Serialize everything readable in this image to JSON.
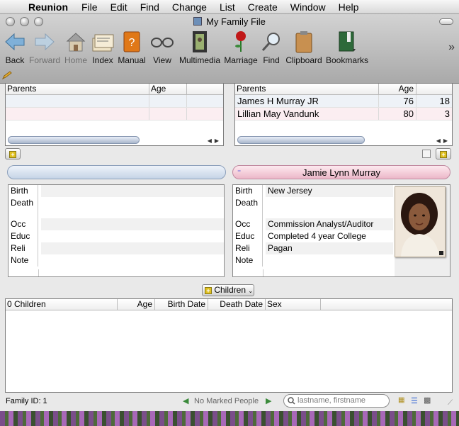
{
  "menubar": {
    "app_name": "Reunion",
    "items": [
      "File",
      "Edit",
      "Find",
      "Change",
      "List",
      "Create",
      "Window",
      "Help"
    ]
  },
  "window": {
    "title": "My Family File"
  },
  "toolbar": {
    "items": [
      {
        "label": "Back",
        "icon": "back-arrow-icon"
      },
      {
        "label": "Forward",
        "icon": "forward-arrow-icon",
        "disabled": true
      },
      {
        "label": "Home",
        "icon": "home-icon",
        "disabled": true
      },
      {
        "label": "Index",
        "icon": "index-cards-icon"
      },
      {
        "label": "Manual",
        "icon": "manual-book-icon"
      },
      {
        "label": "View",
        "icon": "glasses-icon"
      },
      {
        "label": "Multimedia",
        "icon": "film-icon"
      },
      {
        "label": "Marriage",
        "icon": "rose-icon"
      },
      {
        "label": "Find",
        "icon": "magnifier-icon"
      },
      {
        "label": "Clipboard",
        "icon": "clipboard-icon"
      },
      {
        "label": "Bookmarks",
        "icon": "bookmark-book-icon"
      }
    ]
  },
  "left_parents": {
    "headers": [
      "Parents",
      "Age"
    ],
    "rows": [
      [
        "",
        ""
      ],
      [
        "",
        ""
      ]
    ]
  },
  "right_parents": {
    "headers": [
      "Parents",
      "Age"
    ],
    "rows": [
      {
        "name": "James H Murray JR",
        "age": "76",
        "extra": "18"
      },
      {
        "name": "Lillian May Vandunk",
        "age": "80",
        "extra": "3"
      }
    ]
  },
  "left_person": {
    "name": "",
    "fields": [
      "Birth",
      "Death",
      "Occ",
      "Educ",
      "Reli",
      "Note"
    ],
    "values": [
      "",
      "",
      "",
      "",
      "",
      ""
    ]
  },
  "right_person": {
    "name": "Jamie Lynn Murray",
    "fields": [
      "Birth",
      "Death",
      "Occ",
      "Educ",
      "Reli",
      "Note"
    ],
    "values": [
      "New Jersey",
      "",
      "Commission Analyst/Auditor",
      "Completed 4 year College",
      "Pagan",
      ""
    ]
  },
  "children": {
    "button_label": "Children",
    "headers": [
      "0 Children",
      "Age",
      "Birth Date",
      "Death Date",
      "Sex"
    ]
  },
  "status": {
    "family_id": "Family ID: 1",
    "marked": "No Marked People",
    "search_placeholder": "lastname, firstname"
  },
  "colors": {
    "pink": "#f3c9d6",
    "blue": "#c9d7e8",
    "accent": "#3b6bd6"
  }
}
